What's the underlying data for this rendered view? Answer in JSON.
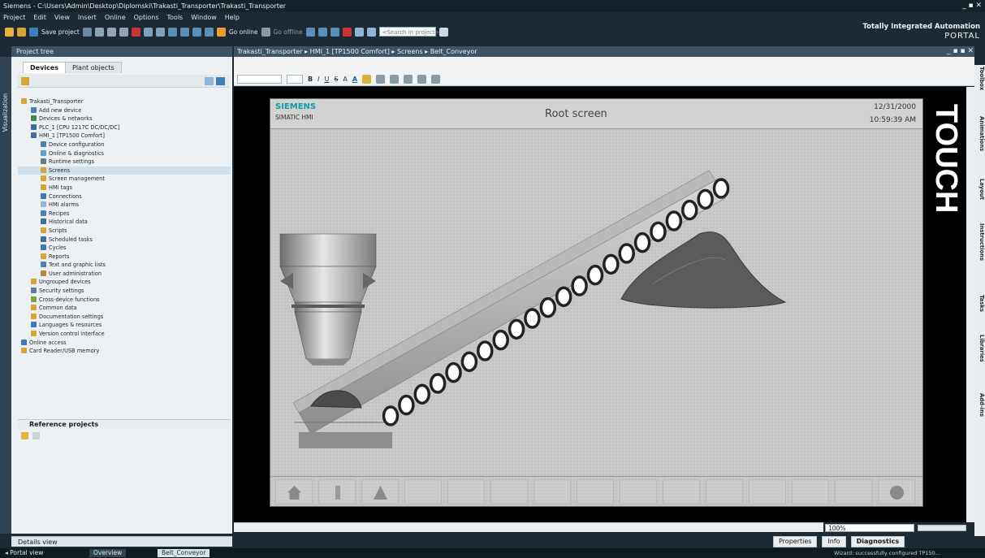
{
  "window": {
    "title": "Siemens - C:\\Users\\Admin\\Desktop\\Diplomski\\Trakasti_Transporter\\Trakasti_Transporter",
    "controls": "_ ▪ ✕"
  },
  "menu": [
    "Project",
    "Edit",
    "View",
    "Insert",
    "Online",
    "Options",
    "Tools",
    "Window",
    "Help"
  ],
  "toolbar": {
    "save_label": "Save project",
    "go_online": "Go online",
    "go_offline": "Go offline",
    "search_placeholder": "<Search in project>"
  },
  "branding": {
    "line1": "Totally Integrated Automation",
    "line2": "PORTAL"
  },
  "project_tree": {
    "title": "Project tree",
    "side_tab": "Visualization",
    "tabs": [
      "Devices",
      "Plant objects"
    ],
    "items": [
      {
        "label": "Trakasti_Transporter",
        "indent": 0,
        "color": "#d9a434"
      },
      {
        "label": "Add new device",
        "indent": 1,
        "color": "#4a7fb8"
      },
      {
        "label": "Devices & networks",
        "indent": 1,
        "color": "#3d8a4e"
      },
      {
        "label": "PLC_1 [CPU 1217C DC/DC/DC]",
        "indent": 1,
        "color": "#3a6e9e"
      },
      {
        "label": "HMI_1 [TP1500 Comfort]",
        "indent": 1,
        "color": "#3a6e9e"
      },
      {
        "label": "Device configuration",
        "indent": 2,
        "color": "#4a7fb8"
      },
      {
        "label": "Online & diagnostics",
        "indent": 2,
        "color": "#5aa0c8"
      },
      {
        "label": "Runtime settings",
        "indent": 2,
        "color": "#6b7b85"
      },
      {
        "label": "Screens",
        "indent": 2,
        "color": "#d9a434",
        "selected": true
      },
      {
        "label": "Screen management",
        "indent": 2,
        "color": "#d9a434"
      },
      {
        "label": "HMI tags",
        "indent": 2,
        "color": "#d9a434"
      },
      {
        "label": "Connections",
        "indent": 2,
        "color": "#3a7ab8"
      },
      {
        "label": "HMI alarms",
        "indent": 2,
        "color": "#8fb6d6"
      },
      {
        "label": "Recipes",
        "indent": 2,
        "color": "#4a7fb8"
      },
      {
        "label": "Historical data",
        "indent": 2,
        "color": "#3a6e9e"
      },
      {
        "label": "Scripts",
        "indent": 2,
        "color": "#d9a434"
      },
      {
        "label": "Scheduled tasks",
        "indent": 2,
        "color": "#3a6e9e"
      },
      {
        "label": "Cycles",
        "indent": 2,
        "color": "#3a7ab8"
      },
      {
        "label": "Reports",
        "indent": 2,
        "color": "#d9a434"
      },
      {
        "label": "Text and graphic lists",
        "indent": 2,
        "color": "#4a7fb8"
      },
      {
        "label": "User administration",
        "indent": 2,
        "color": "#b88a3a"
      },
      {
        "label": "Ungrouped devices",
        "indent": 1,
        "color": "#d9a434"
      },
      {
        "label": "Security settings",
        "indent": 1,
        "color": "#5a7fa8"
      },
      {
        "label": "Cross-device functions",
        "indent": 1,
        "color": "#7aa04a"
      },
      {
        "label": "Common data",
        "indent": 1,
        "color": "#d9a434"
      },
      {
        "label": "Documentation settings",
        "indent": 1,
        "color": "#d9a434"
      },
      {
        "label": "Languages & resources",
        "indent": 1,
        "color": "#3a7ab8"
      },
      {
        "label": "Version control interface",
        "indent": 1,
        "color": "#d9a434"
      },
      {
        "label": "Online access",
        "indent": 0,
        "color": "#3a7ab8"
      },
      {
        "label": "Card Reader/USB memory",
        "indent": 0,
        "color": "#d9a434"
      }
    ],
    "reference_projects": "Reference projects",
    "details_view": "Details view"
  },
  "editor": {
    "breadcrumb": "Trakasti_Transporter  ▸  HMI_1 [TP1500 Comfort]  ▸  Screens  ▸  Belt_Conveyor",
    "controls": "_ ▪ ▪ ✕",
    "format_buttons": [
      "B",
      "I",
      "U",
      "S",
      "A",
      "A"
    ],
    "zoom": "100%"
  },
  "hmi": {
    "brand": "SIEMENS",
    "model": "SIMATIC HMI",
    "screen_title": "Root screen",
    "date": "12/31/2000",
    "time": "10:59:39 AM",
    "bezel_label": "TOUCH"
  },
  "right_tabs": [
    "Toolbox",
    "Animations",
    "Layout",
    "Instructions",
    "Tasks",
    "Libraries",
    "Add-ins"
  ],
  "bottom_tabs": {
    "properties": "Properties",
    "info": "Info",
    "diagnostics": "Diagnostics"
  },
  "taskbar": {
    "portal_view": "Portal view",
    "overview": "Overview",
    "belt": "Belt_Conveyor",
    "status": "Wizard: successfully configured TP150..."
  }
}
